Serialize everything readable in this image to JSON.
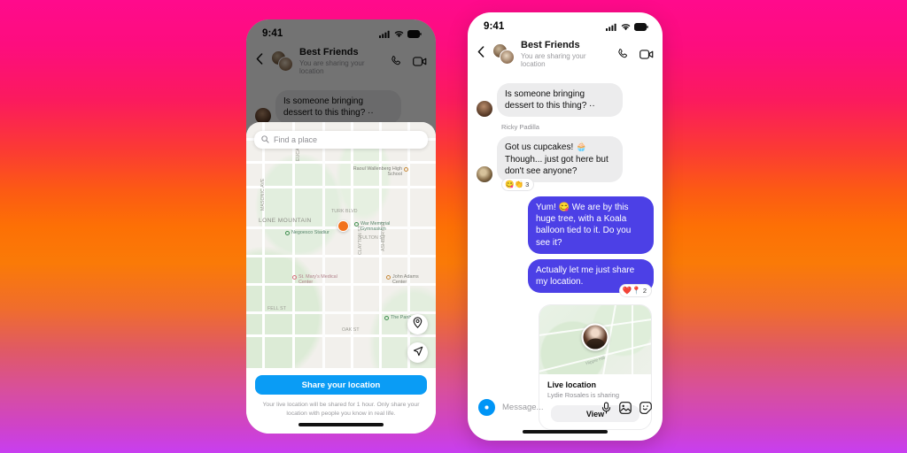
{
  "background": {
    "gradient_from": "#ff0a8c",
    "gradient_mid": "#fd7005",
    "gradient_to": "#c83ef0"
  },
  "colors": {
    "outgoing_bubble": "#4c40e6",
    "incoming_bubble": "#ececed",
    "primary_button": "#0a9cf5",
    "user_location_dot": "#f2711c"
  },
  "phones": {
    "left": {
      "status_bar": {
        "time": "9:41",
        "signal_icon": "signal-bars-icon",
        "wifi_icon": "wifi-icon",
        "battery_icon": "battery-icon"
      },
      "header": {
        "back_icon": "chevron-left-icon",
        "avatar": "group-avatar",
        "title": "Best Friends",
        "subtitle": "You are sharing your location",
        "call_icon": "phone-call-icon",
        "video_icon": "video-camera-icon"
      },
      "messages": [
        {
          "type": "incoming",
          "text": "Is someone bringing dessert to this thing? ··"
        }
      ],
      "sender_name": "Ricky Padilla",
      "map_sheet": {
        "search_placeholder": "Find a place",
        "search_icon": "search-icon",
        "pois": [
          {
            "name": "Raoul Wallenberg High School",
            "kind": "orange"
          },
          {
            "name": "Negoesco Stadiur",
            "kind": "green"
          },
          {
            "name": "War Memorial Gymnasium",
            "kind": "green"
          },
          {
            "name": "St. Mary's Medical Center",
            "kind": "red"
          },
          {
            "name": "John Adams Center",
            "kind": "orange"
          },
          {
            "name": "The Panhandle",
            "kind": "green"
          }
        ],
        "area_labels": [
          "LONE MOUNTAIN"
        ],
        "street_labels": [
          "FULTON ST",
          "TURK BLVD",
          "FELL ST",
          "OAK ST",
          "EUCA BLVD",
          "MASONIC AVE",
          "STANYAN ST",
          "CLAYTON ST",
          "ASHBURY ST"
        ],
        "fabs": [
          {
            "icon": "map-pin-icon"
          },
          {
            "icon": "navigate-arrow-icon"
          }
        ],
        "share_button": "Share your location",
        "disclaimer": "Your live location will be shared for 1 hour. Only share your location with people you know in real life."
      }
    },
    "right": {
      "status_bar": {
        "time": "9:41",
        "signal_icon": "signal-bars-icon",
        "wifi_icon": "wifi-icon",
        "battery_icon": "battery-icon"
      },
      "header": {
        "back_icon": "chevron-left-icon",
        "avatar": "group-avatar",
        "title": "Best Friends",
        "subtitle": "You are sharing your location",
        "call_icon": "phone-call-icon",
        "video_icon": "video-camera-icon"
      },
      "messages": [
        {
          "type": "incoming",
          "text": "Is someone bringing dessert to this thing? ··"
        },
        {
          "type": "sender_label",
          "text": "Ricky Padilla"
        },
        {
          "type": "incoming",
          "text": "Got us cupcakes! 🧁 Though... just got here but don't see anyone?",
          "reactions": {
            "emojis": "😋👏",
            "count": "3"
          }
        },
        {
          "type": "outgoing",
          "text": "Yum! 😋 We are by this huge tree, with a Koala balloon tied to it. Do you see it?"
        },
        {
          "type": "outgoing",
          "text": "Actually let me just share my location.",
          "reactions": {
            "emojis": "❤️📍",
            "count": "2"
          }
        }
      ],
      "location_card": {
        "map_label": "Hippie Hill",
        "avatar": "user-avatar",
        "title": "Live location",
        "subtitle": "Lydie Rosales is sharing",
        "button": "View"
      },
      "composer": {
        "camera_icon": "camera-icon",
        "placeholder": "Message...",
        "mic_icon": "microphone-icon",
        "gallery_icon": "image-icon",
        "sticker_icon": "sticker-icon"
      }
    }
  }
}
